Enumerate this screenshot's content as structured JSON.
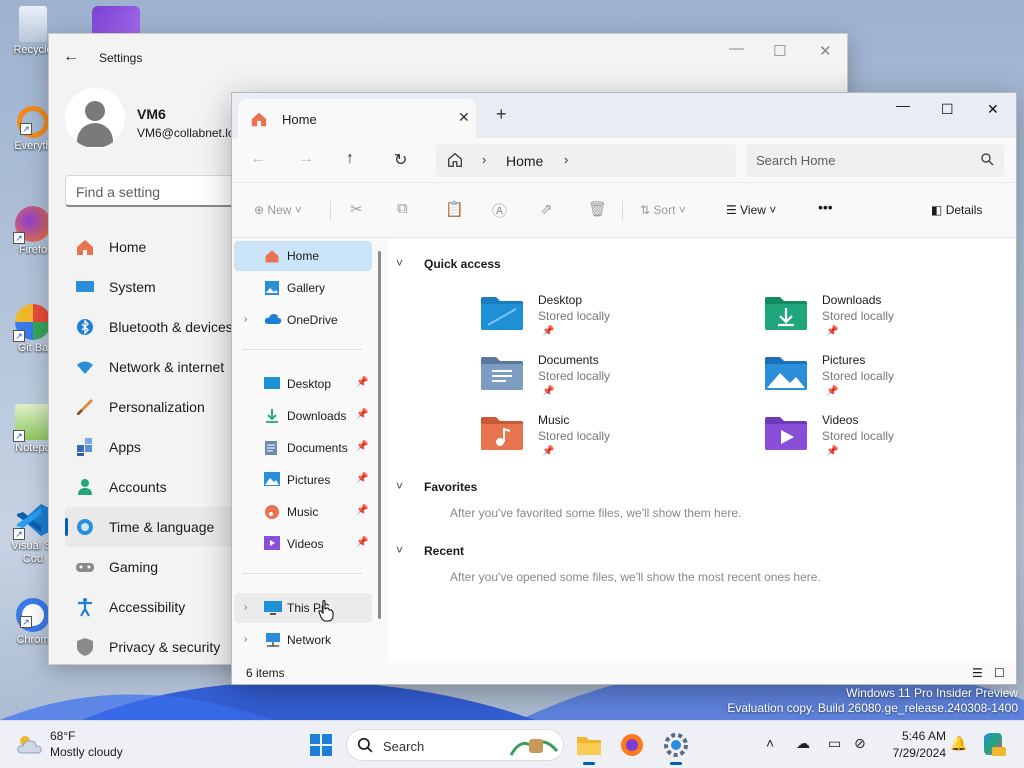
{
  "desktop": {
    "icons": [
      {
        "label": "Recycle"
      },
      {
        "label": "Everyth"
      },
      {
        "label": "Firefo"
      },
      {
        "label": "Git Ba"
      },
      {
        "label": "Notepa"
      },
      {
        "label": "Visual St\nCod"
      },
      {
        "label": "Chrom"
      }
    ],
    "watermark_line1": "Windows 11 Pro Insider Preview",
    "watermark_line2": "Evaluation copy. Build 26080.ge_release.240308-1400"
  },
  "settings": {
    "title": "Settings",
    "user_name": "VM6",
    "user_email": "VM6@collabnet.lo",
    "search_placeholder": "Find a setting",
    "nav": [
      {
        "label": "Home",
        "icon": "home-icon"
      },
      {
        "label": "System",
        "icon": "monitor-icon"
      },
      {
        "label": "Bluetooth & devices",
        "icon": "bluetooth-icon"
      },
      {
        "label": "Network & internet",
        "icon": "wifi-icon"
      },
      {
        "label": "Personalization",
        "icon": "brush-icon"
      },
      {
        "label": "Apps",
        "icon": "apps-icon"
      },
      {
        "label": "Accounts",
        "icon": "person-icon"
      },
      {
        "label": "Time & language",
        "icon": "globe-clock-icon"
      },
      {
        "label": "Gaming",
        "icon": "gamepad-icon"
      },
      {
        "label": "Accessibility",
        "icon": "accessibility-icon"
      },
      {
        "label": "Privacy & security",
        "icon": "shield-icon"
      }
    ],
    "active_item": "Time & language"
  },
  "explorer": {
    "tab_title": "Home",
    "breadcrumb_location": "Home",
    "search_placeholder": "Search Home",
    "commands": {
      "new": "New",
      "sort": "Sort",
      "view": "View",
      "more": "•••",
      "details": "Details"
    },
    "nav_pane": {
      "top": [
        {
          "label": "Home",
          "icon": "home-icon",
          "selected": true
        },
        {
          "label": "Gallery",
          "icon": "gallery-icon"
        },
        {
          "label": "OneDrive",
          "icon": "cloud-icon",
          "expandable": true
        }
      ],
      "pinned": [
        {
          "label": "Desktop",
          "icon": "desktop-folder-icon"
        },
        {
          "label": "Downloads",
          "icon": "download-icon"
        },
        {
          "label": "Documents",
          "icon": "document-icon"
        },
        {
          "label": "Pictures",
          "icon": "pictures-icon"
        },
        {
          "label": "Music",
          "icon": "music-icon"
        },
        {
          "label": "Videos",
          "icon": "videos-icon"
        }
      ],
      "bottom": [
        {
          "label": "This PC",
          "icon": "pc-icon"
        },
        {
          "label": "Network",
          "icon": "network-icon"
        }
      ]
    },
    "quick_access": {
      "heading": "Quick access",
      "items": [
        {
          "name": "Desktop",
          "status": "Stored locally",
          "color": "#1e90d6"
        },
        {
          "name": "Downloads",
          "status": "Stored locally",
          "color": "#1fa67a"
        },
        {
          "name": "Documents",
          "status": "Stored locally",
          "color": "#6c8cb3"
        },
        {
          "name": "Pictures",
          "status": "Stored locally",
          "color": "#2a8fd8"
        },
        {
          "name": "Music",
          "status": "Stored locally",
          "color": "#e8734f"
        },
        {
          "name": "Videos",
          "status": "Stored locally",
          "color": "#8a4fd8"
        }
      ]
    },
    "favorites": {
      "heading": "Favorites",
      "hint": "After you've favorited some files, we'll show them here."
    },
    "recent": {
      "heading": "Recent",
      "hint": "After you've opened some files, we'll show the most recent ones here."
    },
    "status_text": "6 items"
  },
  "taskbar": {
    "weather_temp": "68°F",
    "weather_cond": "Mostly cloudy",
    "search_label": "Search",
    "time": "5:46 AM",
    "date": "7/29/2024"
  },
  "colors": {
    "accent": "#005fb8",
    "selection": "#cce4f7"
  }
}
